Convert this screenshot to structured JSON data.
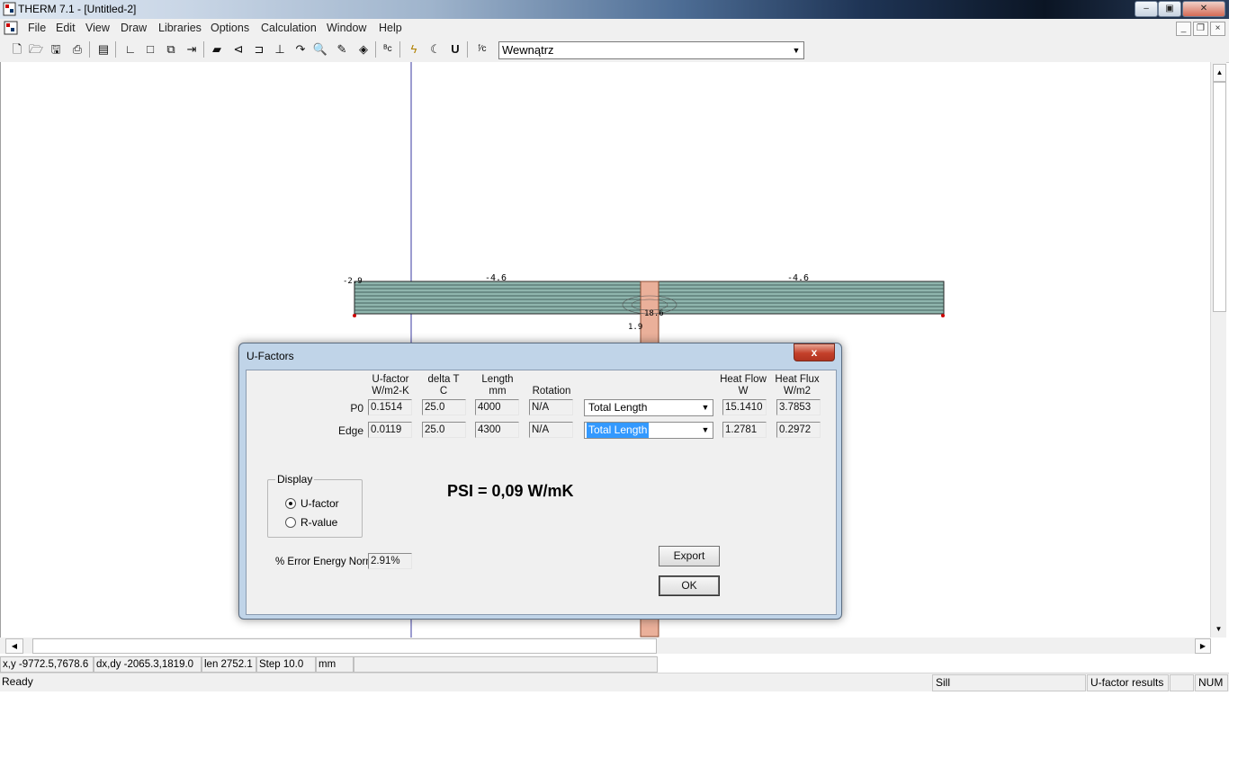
{
  "window": {
    "title": "THERM 7.1 - [Untitled-2]",
    "minimize": "‒",
    "restore": "▣",
    "close": "✕"
  },
  "menu": {
    "items": [
      "File",
      "Edit",
      "View",
      "Draw",
      "Libraries",
      "Options",
      "Calculation",
      "Window",
      "Help"
    ],
    "mdi_minimize": "_",
    "mdi_restore": "❐",
    "mdi_close": "×"
  },
  "toolbar": {
    "boundary_combo_value": "Wewnątrz",
    "icons": [
      "new-file-icon",
      "open-folder-icon",
      "save-icon",
      "print-icon",
      "properties-icon",
      "polygon-icon",
      "rectangle-icon",
      "fill-icon",
      "locate-icon",
      "material-icon",
      "insert-point-icon",
      "boundary-icon",
      "move-icon",
      "arc-icon",
      "zoom-icon",
      "pick-color-icon",
      "fill-void-icon",
      "boundary-condition-icon",
      "calculate-icon",
      "view-results-icon",
      "u-factor-icon",
      "flux-icon"
    ]
  },
  "drawing": {
    "label_top_left": "-4.6",
    "label_top_right": "-4.6",
    "label_small_1": "1.9",
    "label_small_2": "18.6",
    "label_edge": "-2.9",
    "axis_color": "#3a3aa0",
    "slab_color": "#7ea9a0",
    "stud_color": "#e8a58c"
  },
  "dialog": {
    "title": "U-Factors",
    "close": "x",
    "headers": {
      "ufactor": [
        "U-factor",
        "W/m2-K"
      ],
      "deltaT": [
        "delta T",
        "C"
      ],
      "length": [
        "Length",
        "mm"
      ],
      "rotation": [
        "Rotation"
      ],
      "heatflow": [
        "Heat Flow",
        "W"
      ],
      "heatflux": [
        "Heat Flux",
        "W/m2"
      ]
    },
    "rows": [
      {
        "label": "P0",
        "ufactor": "0.1514",
        "deltaT": "25.0",
        "length": "4000",
        "rotation": "N/A",
        "basis": "Total Length",
        "heatflow": "15.1410",
        "heatflux": "3.7853"
      },
      {
        "label": "Edge",
        "ufactor": "0.0119",
        "deltaT": "25.0",
        "length": "4300",
        "rotation": "N/A",
        "basis": "Total Length",
        "heatflow": "1.2781",
        "heatflux": "0.2972"
      }
    ],
    "display_group": "Display",
    "radio_ufactor": "U-factor",
    "radio_rvalue": "R-value",
    "psi_text": "PSI = 0,09 W/mK",
    "error_label": "% Error Energy Norm",
    "error_value": "2.91%",
    "export_button": "Export",
    "ok_button": "OK"
  },
  "coords": {
    "xy": "x,y -9772.5,7678.6",
    "dxdy": "dx,dy -2065.3,1819.0",
    "len": "len 2752.1",
    "step": "Step  10.0",
    "unit": "mm"
  },
  "status": {
    "ready": "Ready",
    "sill": "Sill",
    "results": "U-factor results",
    "num": "NUM"
  }
}
